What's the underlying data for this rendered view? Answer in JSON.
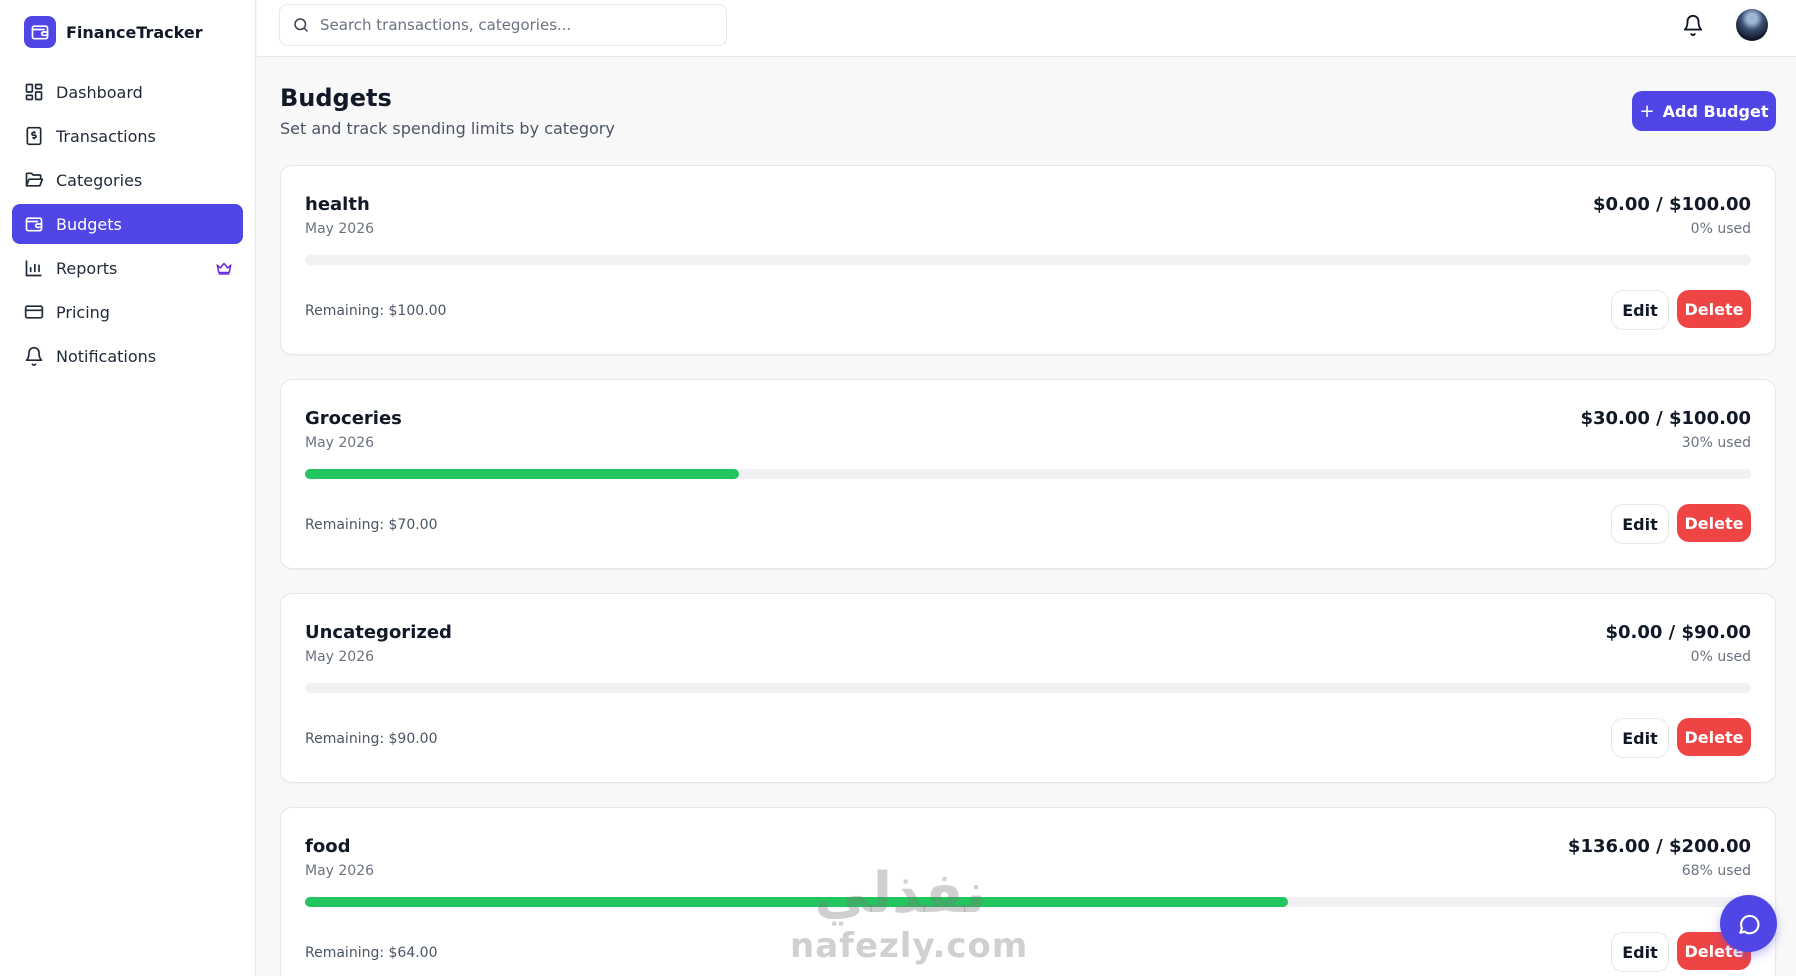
{
  "app": {
    "name": "FinanceTracker"
  },
  "nav": [
    {
      "label": "Dashboard",
      "icon": "layout-grid-icon"
    },
    {
      "label": "Transactions",
      "icon": "receipt-dollar-icon"
    },
    {
      "label": "Categories",
      "icon": "folder-open-icon"
    },
    {
      "label": "Budgets",
      "icon": "wallet-icon",
      "active": true
    },
    {
      "label": "Reports",
      "icon": "bar-chart-icon",
      "badge_icon": "crown-icon"
    },
    {
      "label": "Pricing",
      "icon": "credit-card-icon"
    },
    {
      "label": "Notifications",
      "icon": "bell-icon"
    }
  ],
  "search": {
    "placeholder": "Search transactions, categories..."
  },
  "page": {
    "title": "Budgets",
    "subtitle": "Set and track spending limits by category",
    "add_button_label": "Add Budget"
  },
  "budgets": [
    {
      "name": "health",
      "period": "May 2026",
      "amount": "$0.00 / $100.00",
      "used": "0% used",
      "used_fraction": 0.0,
      "remaining": "Remaining: $100.00"
    },
    {
      "name": "Groceries",
      "period": "May 2026",
      "amount": "$30.00 / $100.00",
      "used": "30% used",
      "used_fraction": 0.3,
      "remaining": "Remaining: $70.00"
    },
    {
      "name": "Uncategorized",
      "period": "May 2026",
      "amount": "$0.00 / $90.00",
      "used": "0% used",
      "used_fraction": 0.0,
      "remaining": "Remaining: $90.00"
    },
    {
      "name": "food",
      "period": "May 2026",
      "amount": "$136.00 / $200.00",
      "used": "68% used",
      "used_fraction": 0.68,
      "remaining": "Remaining: $64.00"
    }
  ],
  "buttons": {
    "edit": "Edit",
    "delete": "Delete"
  },
  "watermark": {
    "arabic": "نفذلي",
    "latin": "nafezly.com"
  },
  "colors": {
    "accent": "#4f46e5",
    "progress": "#22c55e",
    "danger": "#ef4444"
  }
}
